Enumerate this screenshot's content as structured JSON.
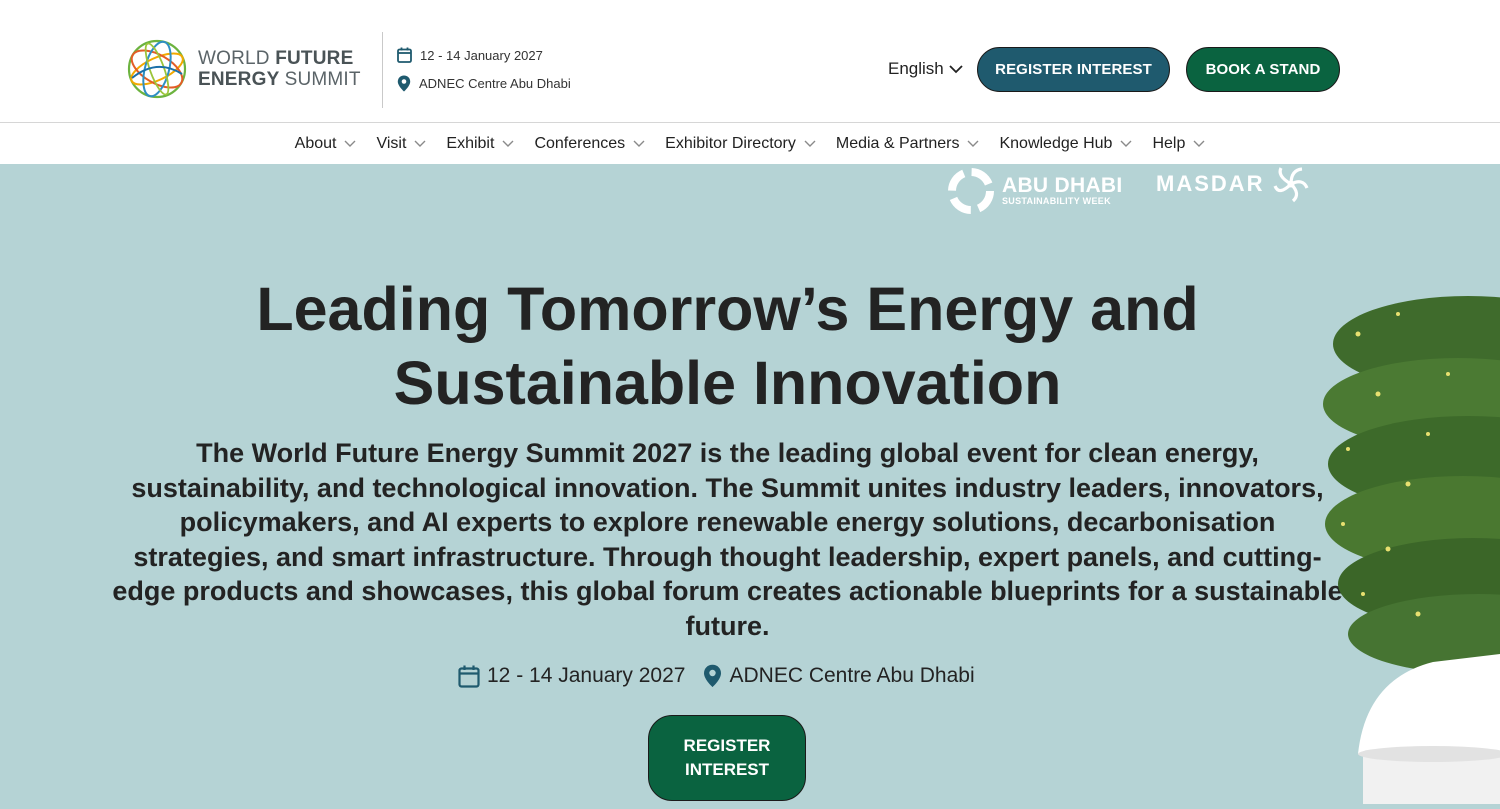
{
  "header": {
    "logo": {
      "line1_regular": "WORLD ",
      "line1_bold": "FUTURE",
      "line2_bold": "ENERGY ",
      "line2_regular": "SUMMIT"
    },
    "date": "12 - 14 January 2027",
    "venue": "ADNEC Centre Abu Dhabi",
    "language": "English",
    "register_label": "REGISTER INTEREST",
    "stand_label": "BOOK A STAND",
    "colors": {
      "register_bg": "#1f5a6e",
      "stand_bg": "#0a6340"
    }
  },
  "nav": {
    "items": [
      {
        "label": "About"
      },
      {
        "label": "Visit"
      },
      {
        "label": "Exhibit"
      },
      {
        "label": "Conferences"
      },
      {
        "label": "Exhibitor Directory"
      },
      {
        "label": "Media & Partners"
      },
      {
        "label": "Knowledge Hub"
      },
      {
        "label": "Help"
      }
    ]
  },
  "hero": {
    "partners": {
      "adsw_line1": "ABU DHABI",
      "adsw_line2": "SUSTAINABILITY WEEK",
      "masdar": "MASDAR"
    },
    "title": "Leading Tomorrow’s Energy and Sustainable Innovation",
    "description": "The World Future Energy Summit 2027 is the leading global event for clean energy, sustainability, and technological innovation. The Summit unites industry leaders, innovators, policymakers, and AI experts to explore renewable energy solutions, decarbonisation strategies, and smart infrastructure. Through thought leadership, expert panels, and cutting-edge products and showcases, this global forum creates  actionable blueprints for a sustainable future.",
    "date": "12 - 14 January 2027",
    "venue": "ADNEC Centre Abu Dhabi",
    "cta_line1": "REGISTER",
    "cta_line2": "INTEREST",
    "background": "#b5d3d5"
  }
}
